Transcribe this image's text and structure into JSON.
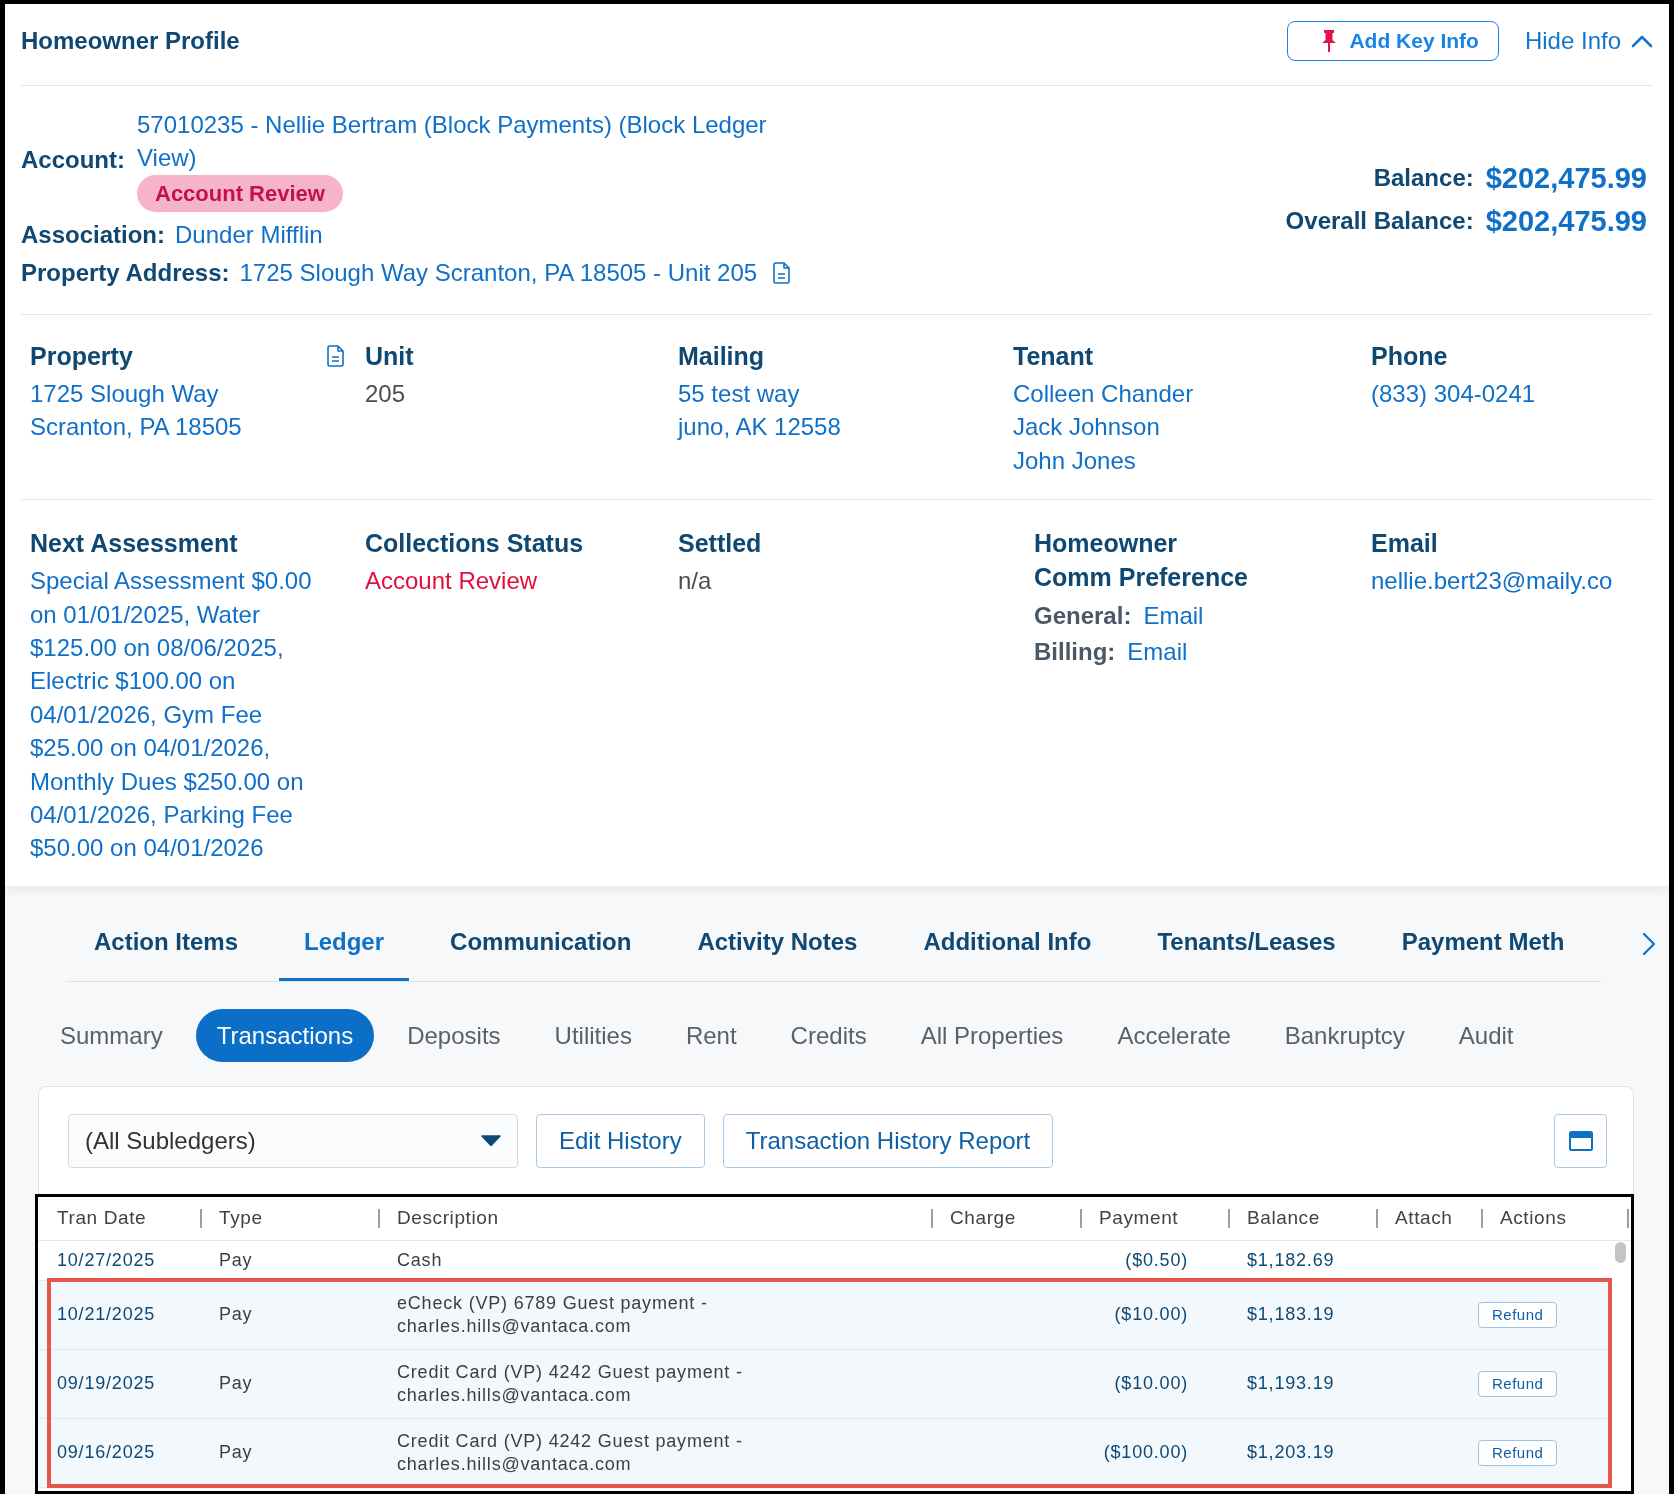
{
  "header": {
    "title": "Homeowner Profile",
    "add_key_info": "Add Key Info",
    "hide_info": "Hide Info"
  },
  "account": {
    "label": "Account:",
    "value": "57010235 - Nellie Bertram (Block Payments) (Block Ledger View)",
    "badge": "Account Review"
  },
  "association": {
    "label": "Association:",
    "value": "Dunder Mifflin"
  },
  "property_address": {
    "label": "Property Address:",
    "value": "1725 Slough Way Scranton, PA 18505 - Unit 205"
  },
  "balances": [
    {
      "label": "Balance:",
      "value": "$202,475.99"
    },
    {
      "label": "Overall Balance:",
      "value": "$202,475.99"
    }
  ],
  "detail_rows": [
    {
      "fields": [
        {
          "kind": "address",
          "heading": "Property",
          "lines": [
            "1725 Slough Way",
            "Scranton, PA 18505"
          ]
        },
        {
          "kind": "text",
          "heading": "Unit",
          "lines": [
            "205"
          ]
        },
        {
          "kind": "links",
          "heading": "Mailing",
          "lines": [
            "55 test way",
            "juno, AK 12558"
          ]
        },
        {
          "kind": "links",
          "heading": "Tenant",
          "lines": [
            "Colleen Chander",
            "Jack Johnson",
            "John Jones"
          ]
        },
        {
          "kind": "links",
          "heading": "Phone",
          "lines": [
            "(833) 304-0241"
          ]
        }
      ]
    },
    {
      "fields": [
        {
          "kind": "links",
          "heading": "Next Assessment",
          "lines": [
            "Special Assessment $0.00 on 01/01/2025, Water $125.00 on 08/06/2025, Electric $100.00 on 04/01/2026, Gym Fee $25.00 on 04/01/2026, Monthly Dues $250.00 on 04/01/2026, Parking Fee $50.00 on 04/01/2026"
          ]
        },
        {
          "kind": "status",
          "heading": "Collections Status",
          "lines": [
            "Account Review"
          ]
        },
        {
          "kind": "text",
          "heading": "Settled",
          "lines": [
            "n/a"
          ]
        },
        {
          "kind": "preferences",
          "heading": "Homeowner Comm Preference",
          "preferences": [
            {
              "label": "General:",
              "value": "Email"
            },
            {
              "label": "Billing:",
              "value": "Email"
            }
          ]
        },
        {
          "kind": "links",
          "heading": "Email",
          "lines": [
            "nellie.bert23@maily.co"
          ]
        }
      ]
    }
  ],
  "tabs": [
    {
      "label": "Action Items",
      "selected": false
    },
    {
      "label": "Ledger",
      "selected": true
    },
    {
      "label": "Communication",
      "selected": false
    },
    {
      "label": "Activity Notes",
      "selected": false
    },
    {
      "label": "Additional Info",
      "selected": false
    },
    {
      "label": "Tenants/Leases",
      "selected": false
    },
    {
      "label": "Payment Meth",
      "selected": false
    }
  ],
  "subtabs": [
    {
      "label": "Summary",
      "selected": false
    },
    {
      "label": "Transactions",
      "selected": true
    },
    {
      "label": "Deposits",
      "selected": false
    },
    {
      "label": "Utilities",
      "selected": false
    },
    {
      "label": "Rent",
      "selected": false
    },
    {
      "label": "Credits",
      "selected": false
    },
    {
      "label": "All Properties",
      "selected": false
    },
    {
      "label": "Accelerate",
      "selected": false
    },
    {
      "label": "Bankruptcy",
      "selected": false
    },
    {
      "label": "Audit",
      "selected": false
    }
  ],
  "toolbar": {
    "subledger_select": "(All Subledgers)",
    "buttons": [
      "Edit History",
      "Transaction History Report"
    ]
  },
  "table": {
    "columns": [
      "Tran Date",
      "Type",
      "Description",
      "Charge",
      "Payment",
      "Balance",
      "Attach",
      "Actions"
    ],
    "rows": [
      {
        "tran_date": "10/27/2025",
        "type": "Pay",
        "description": "Cash",
        "payment": "($0.50)",
        "balance": "$1,182.69",
        "highlighted": false
      },
      {
        "tran_date": "10/21/2025",
        "type": "Pay",
        "description": "eCheck (VP) 6789 Guest payment - charles.hills@vantaca.com",
        "payment": "($10.00)",
        "balance": "$1,183.19",
        "action": "Refund",
        "highlighted": true
      },
      {
        "tran_date": "09/19/2025",
        "type": "Pay",
        "description": "Credit Card (VP) 4242 Guest payment - charles.hills@vantaca.com",
        "payment": "($10.00)",
        "balance": "$1,193.19",
        "action": "Refund",
        "highlighted": true
      },
      {
        "tran_date": "09/16/2025",
        "type": "Pay",
        "description": "Credit Card (VP) 4242 Guest payment - charles.hills@vantaca.com",
        "payment": "($100.00)",
        "balance": "$1,203.19",
        "action": "Refund",
        "highlighted": true
      }
    ]
  }
}
